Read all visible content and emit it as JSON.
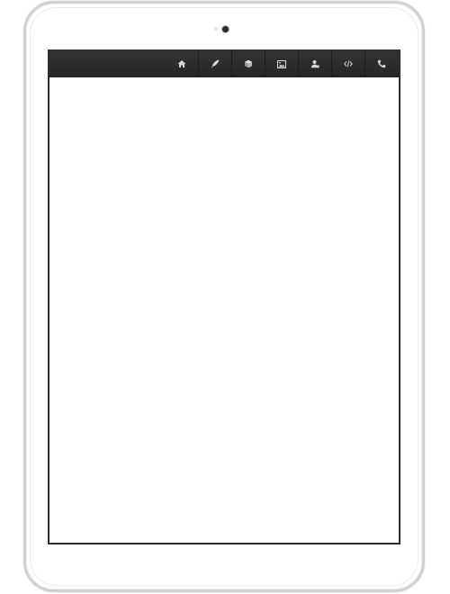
{
  "device": {
    "frame_color": "#ffffff",
    "camera": "front-camera"
  },
  "navbar": {
    "background": "#2b2b2b",
    "icon_color": "#d6d6d6",
    "items": [
      {
        "icon": "home-icon"
      },
      {
        "icon": "quill-icon"
      },
      {
        "icon": "cube-icon"
      },
      {
        "icon": "image-icon"
      },
      {
        "icon": "user-icon"
      },
      {
        "icon": "code-icon"
      },
      {
        "icon": "phone-icon"
      }
    ]
  },
  "content": {
    "background": "#ffffff"
  }
}
